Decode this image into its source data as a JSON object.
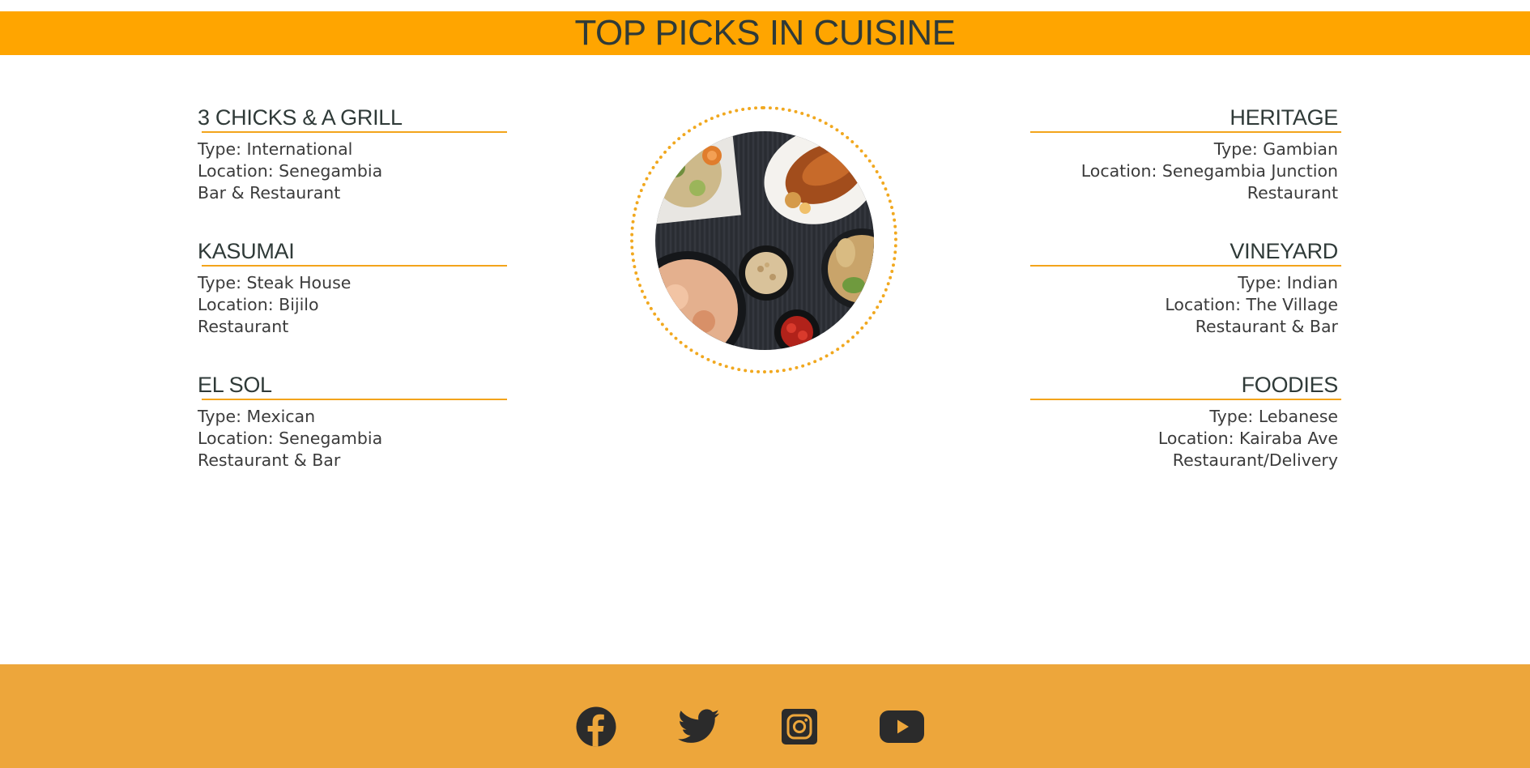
{
  "header": {
    "title": "TOP PICKS IN CUISINE"
  },
  "left_column": [
    {
      "name": "3 CHICKS & A GRILL",
      "type": "Type: International",
      "location_1": "Location: Senegambia",
      "location_2": "Bar & Restaurant"
    },
    {
      "name": "KASUMAI",
      "type": "Type: Steak House",
      "location_1": "Location: Bijilo",
      "location_2": "Restaurant"
    },
    {
      "name": "EL SOL",
      "type": "Type: Mexican",
      "location_1": "Location: Senegambia",
      "location_2": "Restaurant & Bar"
    }
  ],
  "right_column": [
    {
      "name": "HERITAGE",
      "type": "Type: Gambian",
      "location_1": "Location: Senegambia Junction",
      "location_2": "Restaurant"
    },
    {
      "name": "VINEYARD",
      "type": "Type: Indian",
      "location_1": "Location: The Village",
      "location_2": "Restaurant & Bar"
    },
    {
      "name": "FOODIES",
      "type": "Type: Lebanese",
      "location_1": "Location: Kairaba Ave",
      "location_2": "Restaurant/Delivery"
    }
  ],
  "center_image": {
    "icon": "food-bowls-image"
  },
  "footer": {
    "social_icons": [
      "facebook-icon",
      "twitter-icon",
      "instagram-icon",
      "youtube-icon"
    ]
  },
  "colors": {
    "banner": "#ffa500",
    "footer": "#eda63b",
    "accent_rule": "#f3a41b",
    "heading_text": "#2f3a38",
    "icon": "#2b2b2b"
  }
}
